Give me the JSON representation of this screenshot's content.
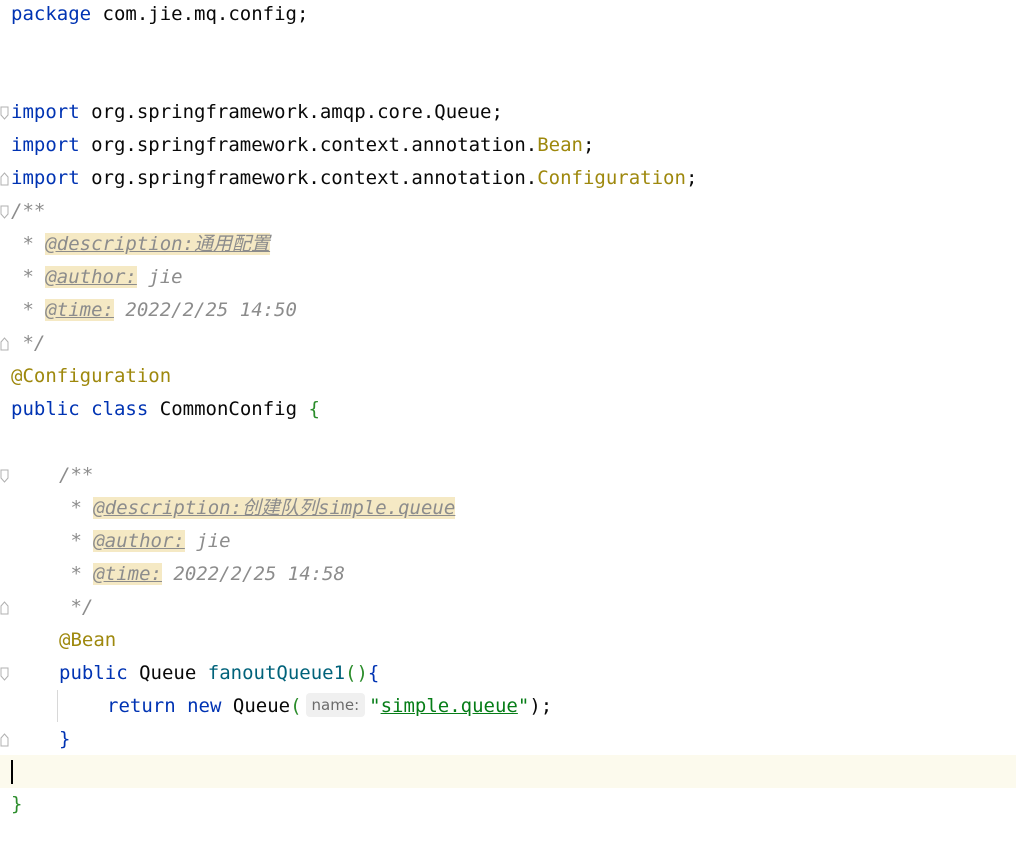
{
  "editor": {
    "package_kw": "package",
    "package_name": "com.jie.mq.config",
    "semicolon": ";",
    "imports": [
      {
        "kw": "import",
        "prefix": "org.springframework.amqp.core.",
        "name": "Queue",
        "highlight": false
      },
      {
        "kw": "import",
        "prefix": "org.springframework.context.annotation.",
        "name": "Bean",
        "highlight": true
      },
      {
        "kw": "import",
        "prefix": "org.springframework.context.annotation.",
        "name": "Configuration",
        "highlight": true
      }
    ],
    "class_doc": {
      "open": "/**",
      "star": " * ",
      "desc_tag": "@description:",
      "desc_text": "通用配置",
      "author_tag": "@author:",
      "author_text": " jie",
      "time_tag": "@time:",
      "time_text": " 2022/2/25 14:50",
      "close": " */"
    },
    "class_annotation": "@Configuration",
    "class_kw_public": "public",
    "class_kw_class": "class",
    "class_name": "CommonConfig",
    "open_brace": "{",
    "method_doc": {
      "open": "/**",
      "star": " * ",
      "desc_tag": "@description:",
      "desc_text": "创建队列simple.queue",
      "author_tag": "@author:",
      "author_text": " jie",
      "time_tag": "@time:",
      "time_text": " 2022/2/25 14:58",
      "close": " */"
    },
    "method_annotation": "@Bean",
    "method_kw_public": "public",
    "method_return_type": "Queue",
    "method_name": "fanoutQueue1",
    "method_parens": "()",
    "return_kw": "return",
    "new_kw": "new",
    "ctor_type": "Queue",
    "param_hint": "name:",
    "string_literal": "simple.queue",
    "close_paren_semicolon": ");",
    "close_brace": "}",
    "colors": {
      "keyword": "#0033b3",
      "annotation": "#9e880d",
      "comment": "#8c8c8c",
      "string": "#067d17",
      "method": "#00627a",
      "current_line": "#fcfaed"
    }
  }
}
